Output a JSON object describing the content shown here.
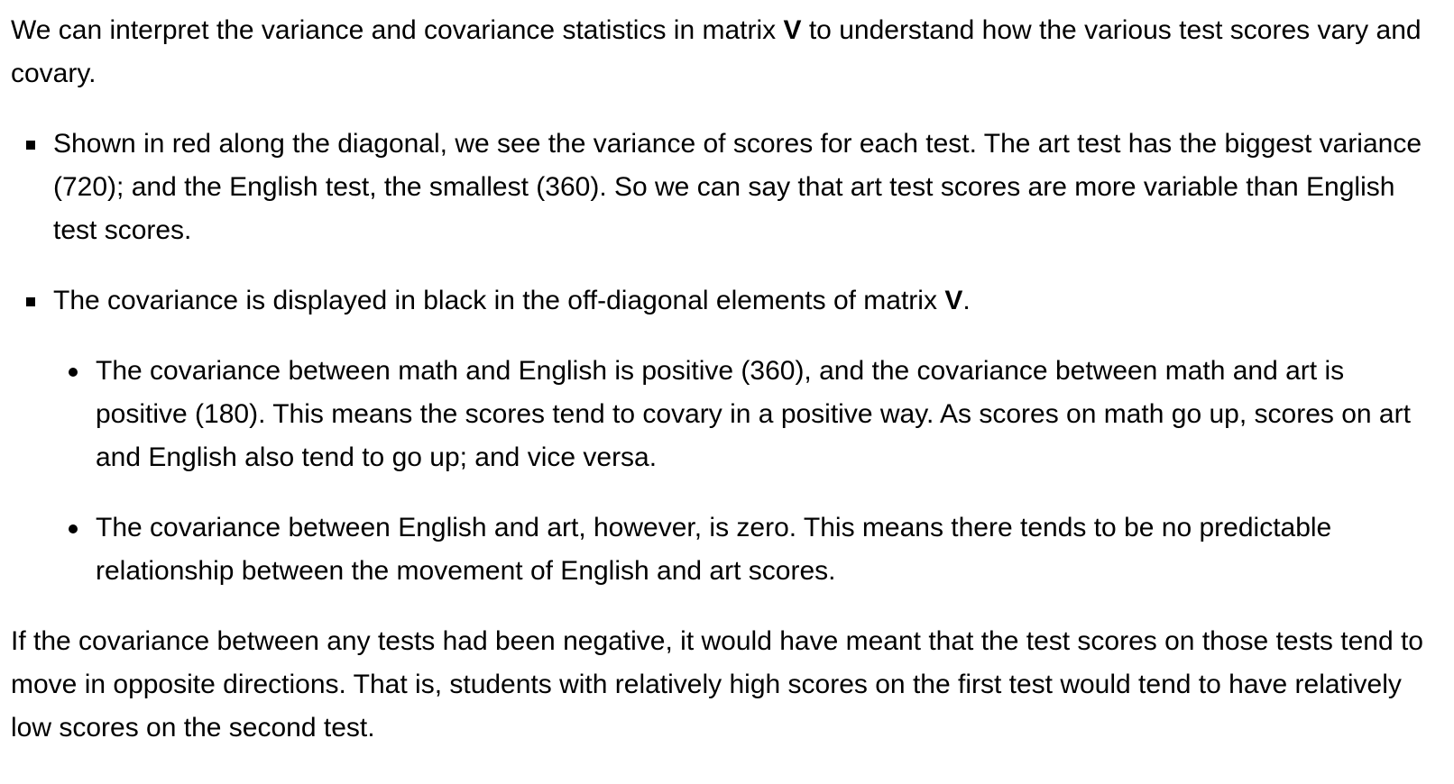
{
  "intro": {
    "before_bold": "We can interpret the variance and covariance statistics in matrix ",
    "bold": "V",
    "after_bold": " to understand how the various test scores vary and covary."
  },
  "bullets": [
    {
      "text": "Shown in red along the diagonal, we see the variance of scores for each test. The art test has the biggest variance (720); and the English test, the smallest (360). So we can say that art test scores are more variable than English test scores."
    },
    {
      "before_bold": "The covariance is displayed in black in the off-diagonal elements of matrix ",
      "bold": "V",
      "after_bold": ".",
      "sub_bullets": [
        "The covariance between math and English is positive (360), and the covariance between math and art is positive (180). This means the scores tend to covary in a positive way. As scores on math go up, scores on art and English also tend to go up; and vice versa.",
        "The covariance between English and art, however, is zero. This means there tends to be no predictable relationship between the movement of English and art scores."
      ]
    }
  ],
  "conclusion": "If the covariance between any tests had been negative, it would have meant that the test scores on those tests tend to move in opposite directions. That is, students with relatively high scores on the first test would tend to have relatively low scores on the second test.",
  "icons": {
    "bullet_level1": "square-bullet-icon",
    "bullet_level2": "disc-bullet-icon"
  }
}
